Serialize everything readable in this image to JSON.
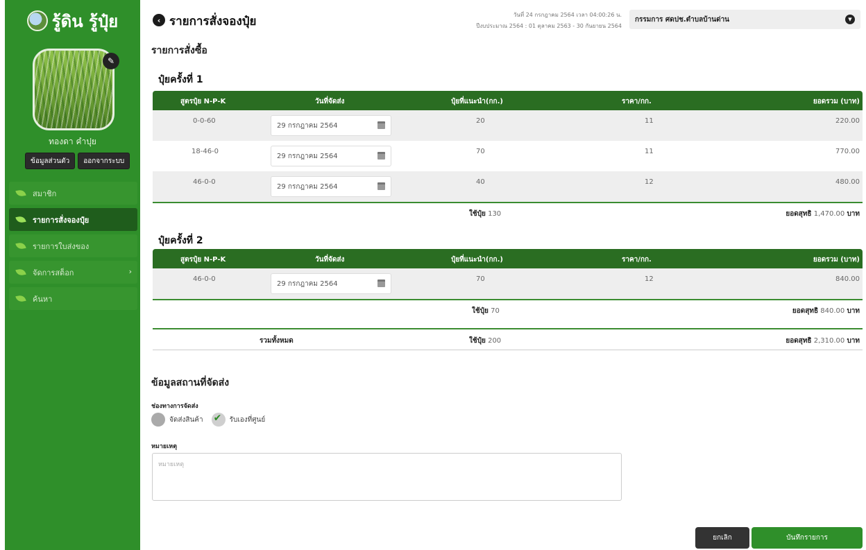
{
  "brand": {
    "name": "รู้ดิน รู้ปุ๋ย"
  },
  "profile": {
    "name": "ทองดา คำปุย",
    "buttons": {
      "info": "ข้อมูลส่วนตัว",
      "logout": "ออกจากระบบ"
    }
  },
  "nav": {
    "items": [
      {
        "label": "สมาชิก"
      },
      {
        "label": "รายการสั่งจองปุ๋ย"
      },
      {
        "label": "รายการใบส่งของ"
      },
      {
        "label": "จัดการสต็อก"
      },
      {
        "label": "ค้นหา"
      }
    ]
  },
  "header": {
    "title": "รายการสั่งจองปุ๋ย",
    "date_line1": "วันที่ 24 กรกฎาคม 2564 เวลา 04:00:26 น.",
    "date_line2": "ปีงบประมาณ 2564 : 01 ตุลาคม 2563 - 30 กันยายน 2564",
    "org": "กรรมการ ศดปช.ตำบลบ้านด่าน"
  },
  "order": {
    "section_title": "รายการสั่งซื้อ",
    "columns": [
      "สูตรปุ๋ย N-P-K",
      "วันที่จัดส่ง",
      "ปุ๋ยที่แนะนำ(กก.)",
      "ราคา/กก.",
      "ยอดรวม (บาท)"
    ],
    "rounds": [
      {
        "title": "ปุ๋ยครั้งที่ 1",
        "rows": [
          {
            "formula": "0-0-60",
            "date": "29 กรกฎาคม 2564",
            "qty": "20",
            "price": "11",
            "total": "220.00"
          },
          {
            "formula": "18-46-0",
            "date": "29 กรกฎาคม 2564",
            "qty": "70",
            "price": "11",
            "total": "770.00"
          },
          {
            "formula": "46-0-0",
            "date": "29 กรกฎาคม 2564",
            "qty": "40",
            "price": "12",
            "total": "480.00"
          }
        ],
        "summary": {
          "use_label": "ใช้ปุ๋ย",
          "use_value": "130",
          "net_label": "ยอดสุทธิ",
          "net_value": "1,470.00",
          "unit": "บาท"
        }
      },
      {
        "title": "ปุ๋ยครั้งที่ 2",
        "rows": [
          {
            "formula": "46-0-0",
            "date": "29 กรกฎาคม 2564",
            "qty": "70",
            "price": "12",
            "total": "840.00"
          }
        ],
        "summary": {
          "use_label": "ใช้ปุ๋ย",
          "use_value": "70",
          "net_label": "ยอดสุทธิ",
          "net_value": "840.00",
          "unit": "บาท"
        }
      }
    ],
    "grand": {
      "label": "รวมทั้งหมด",
      "use_label": "ใช้ปุ๋ย",
      "use_value": "200",
      "net_label": "ยอดสุทธิ",
      "net_value": "2,310.00",
      "unit": "บาท"
    }
  },
  "shipping": {
    "title": "ข้อมูลสถานที่จัดส่ง",
    "channel_label": "ช่องทางการจัดส่ง",
    "options": [
      {
        "label": "จัดส่งสินค้า",
        "checked": false
      },
      {
        "label": "รับเองที่ศูนย์",
        "checked": true
      }
    ],
    "note_label": "หมายเหตุ",
    "note_placeholder": "หมายเหตุ"
  },
  "actions": {
    "cancel": "ยกเลิก",
    "save": "บันทึกรายการ"
  },
  "colors": {
    "sidebar": "#2f8f2a",
    "table_header": "#2a6d22",
    "nav_active": "#1f5d1c",
    "accent": "#3a8c30"
  }
}
